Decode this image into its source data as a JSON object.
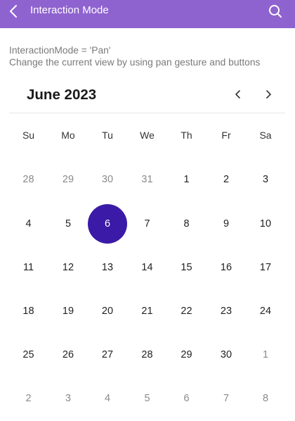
{
  "app_bar": {
    "title": "Interaction Mode",
    "back_icon": "chevron-left-icon",
    "search_icon": "search-icon",
    "color": "#8f63cf"
  },
  "description": {
    "line1": "InteractionMode = 'Pan'",
    "line2": "Change the current view by using pan gesture and buttons"
  },
  "calendar": {
    "month_label": "June 2023",
    "prev_icon": "chevron-left-icon",
    "next_icon": "chevron-right-icon",
    "selection_color": "#3a1aa6",
    "weekdays": [
      "Su",
      "Mo",
      "Tu",
      "We",
      "Th",
      "Fr",
      "Sa"
    ],
    "weeks": [
      [
        {
          "day": "28",
          "month": "prev"
        },
        {
          "day": "29",
          "month": "prev"
        },
        {
          "day": "30",
          "month": "prev"
        },
        {
          "day": "31",
          "month": "prev"
        },
        {
          "day": "1",
          "month": "current"
        },
        {
          "day": "2",
          "month": "current"
        },
        {
          "day": "3",
          "month": "current"
        }
      ],
      [
        {
          "day": "4",
          "month": "current"
        },
        {
          "day": "5",
          "month": "current"
        },
        {
          "day": "6",
          "month": "current",
          "selected": true
        },
        {
          "day": "7",
          "month": "current"
        },
        {
          "day": "8",
          "month": "current"
        },
        {
          "day": "9",
          "month": "current"
        },
        {
          "day": "10",
          "month": "current"
        }
      ],
      [
        {
          "day": "11",
          "month": "current"
        },
        {
          "day": "12",
          "month": "current"
        },
        {
          "day": "13",
          "month": "current"
        },
        {
          "day": "14",
          "month": "current"
        },
        {
          "day": "15",
          "month": "current"
        },
        {
          "day": "16",
          "month": "current"
        },
        {
          "day": "17",
          "month": "current"
        }
      ],
      [
        {
          "day": "18",
          "month": "current"
        },
        {
          "day": "19",
          "month": "current"
        },
        {
          "day": "20",
          "month": "current"
        },
        {
          "day": "21",
          "month": "current"
        },
        {
          "day": "22",
          "month": "current"
        },
        {
          "day": "23",
          "month": "current"
        },
        {
          "day": "24",
          "month": "current"
        }
      ],
      [
        {
          "day": "25",
          "month": "current"
        },
        {
          "day": "26",
          "month": "current"
        },
        {
          "day": "27",
          "month": "current"
        },
        {
          "day": "28",
          "month": "current"
        },
        {
          "day": "29",
          "month": "current"
        },
        {
          "day": "30",
          "month": "current"
        },
        {
          "day": "1",
          "month": "next"
        }
      ],
      [
        {
          "day": "2",
          "month": "next"
        },
        {
          "day": "3",
          "month": "next"
        },
        {
          "day": "4",
          "month": "next"
        },
        {
          "day": "5",
          "month": "next"
        },
        {
          "day": "6",
          "month": "next"
        },
        {
          "day": "7",
          "month": "next"
        },
        {
          "day": "8",
          "month": "next"
        }
      ]
    ]
  }
}
